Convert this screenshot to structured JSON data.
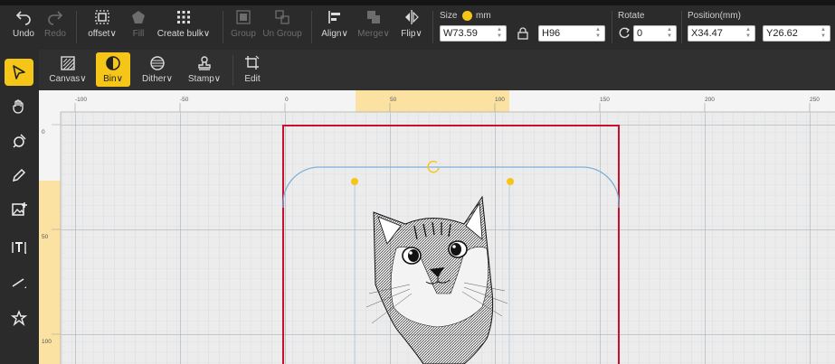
{
  "toolbar": {
    "undo": "Undo",
    "redo": "Redo",
    "offset": "offset",
    "fill": "Fill",
    "create_bulk": "Create bulk",
    "group": "Group",
    "ungroup": "Un Group",
    "align": "Align",
    "merge": "Merge",
    "flip": "Flip",
    "size_label": "Size",
    "unit": "mm",
    "width": "W73.59",
    "height": "H96",
    "rotate_label": "Rotate",
    "rotate": "0",
    "position_label": "Position(mm)",
    "pos_x": "X34.47",
    "pos_y": "Y26.62"
  },
  "subbar": {
    "canvas": "Canvas",
    "bin": "Bin",
    "dither": "Dither",
    "stamp": "Stamp",
    "edit": "Edit"
  },
  "ruler": {
    "top": [
      "-100",
      "-50",
      "0",
      "50",
      "100",
      "150",
      "200",
      "250"
    ],
    "left": [
      "0",
      "50",
      "100"
    ]
  },
  "colors": {
    "accent": "#f5c518",
    "toolbar": "#2b2b2b",
    "canvas_border": "#c8102e",
    "selection": "#7fb0d8",
    "grid": "#c9cfd6"
  },
  "icons": {
    "left_tools": [
      "select-arrow-icon",
      "hand-pan-icon",
      "pen-shape-icon",
      "pencil-icon",
      "image-add-icon",
      "text-icon",
      "line-icon",
      "magic-shape-icon"
    ]
  }
}
